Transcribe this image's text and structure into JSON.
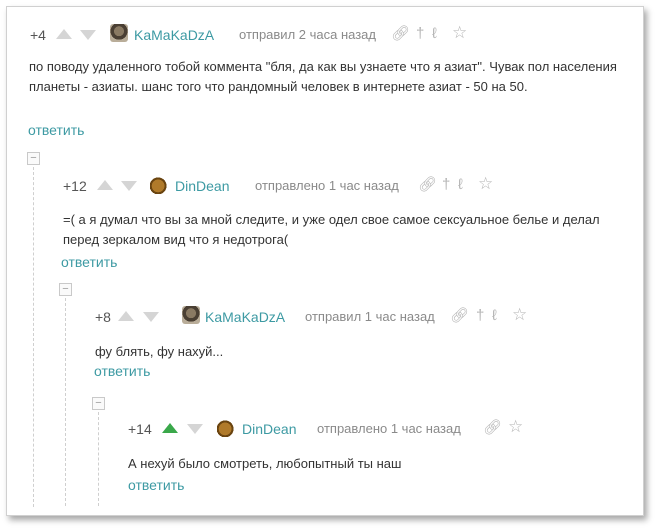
{
  "comments": [
    {
      "rating": "+4",
      "author": "KaMaKaDzA",
      "posted": "отправил 2 часа назад",
      "text": "по поводу удаленного тобой коммента \"бля, да как вы узнаете что я азиат\". Чувак пол населения планеты - азиаты. шанс того что рандомный человек в интернете азиат - 50 на 50.",
      "reply": "ответить"
    },
    {
      "rating": "+12",
      "author": "DinDean",
      "posted": "отправлено 1 час назад",
      "text": "=( а я думал что вы за мной следите, и уже одел свое самое сексуальное белье и делал перед зеркалом вид что я недотрога(",
      "reply": "ответить"
    },
    {
      "rating": "+8",
      "author": "KaMaKaDzA",
      "posted": "отправил 1 час назад",
      "text": "фу блять, фу нахуй...",
      "reply": "ответить"
    },
    {
      "rating": "+14",
      "author": "DinDean",
      "posted": "отправлено 1 час назад",
      "text": "А нехуй было смотреть, любопытный ты наш",
      "reply": "ответить"
    }
  ],
  "collapse_glyph": "−",
  "icons": {
    "link": "link-icon",
    "pin": "pin-icon",
    "tag": "tag-icon",
    "star": "star-icon"
  },
  "colors": {
    "author": "#3d9aa3",
    "upvote_active": "#3aa84a",
    "muted": "#8a8a8a"
  }
}
